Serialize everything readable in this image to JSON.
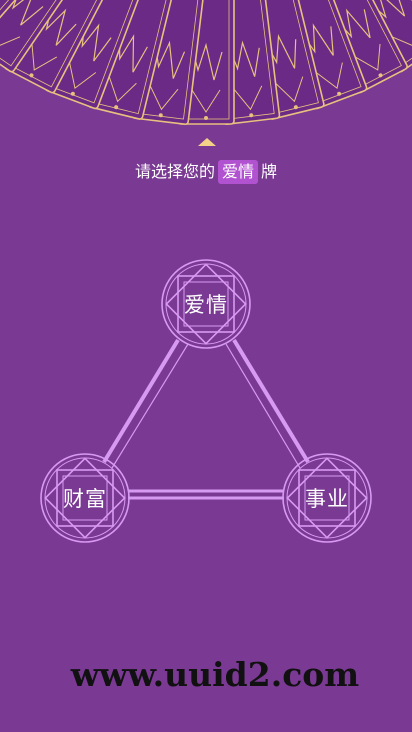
{
  "deck": {
    "card_count": 17
  },
  "prompt": {
    "before": "请选择您的",
    "topic": "爱情",
    "after": "牌"
  },
  "spread": {
    "love": "爱情",
    "career": "事业",
    "wealth": "财富"
  },
  "watermark": "www.uuid2.com",
  "colors": {
    "background": "#7a3993",
    "card_fill": "#6a2a86",
    "card_trim": "#e9c07f",
    "accent_gold": "#f3d288",
    "node_stroke": "#d79af2",
    "topic_badge": "#b152d1"
  }
}
